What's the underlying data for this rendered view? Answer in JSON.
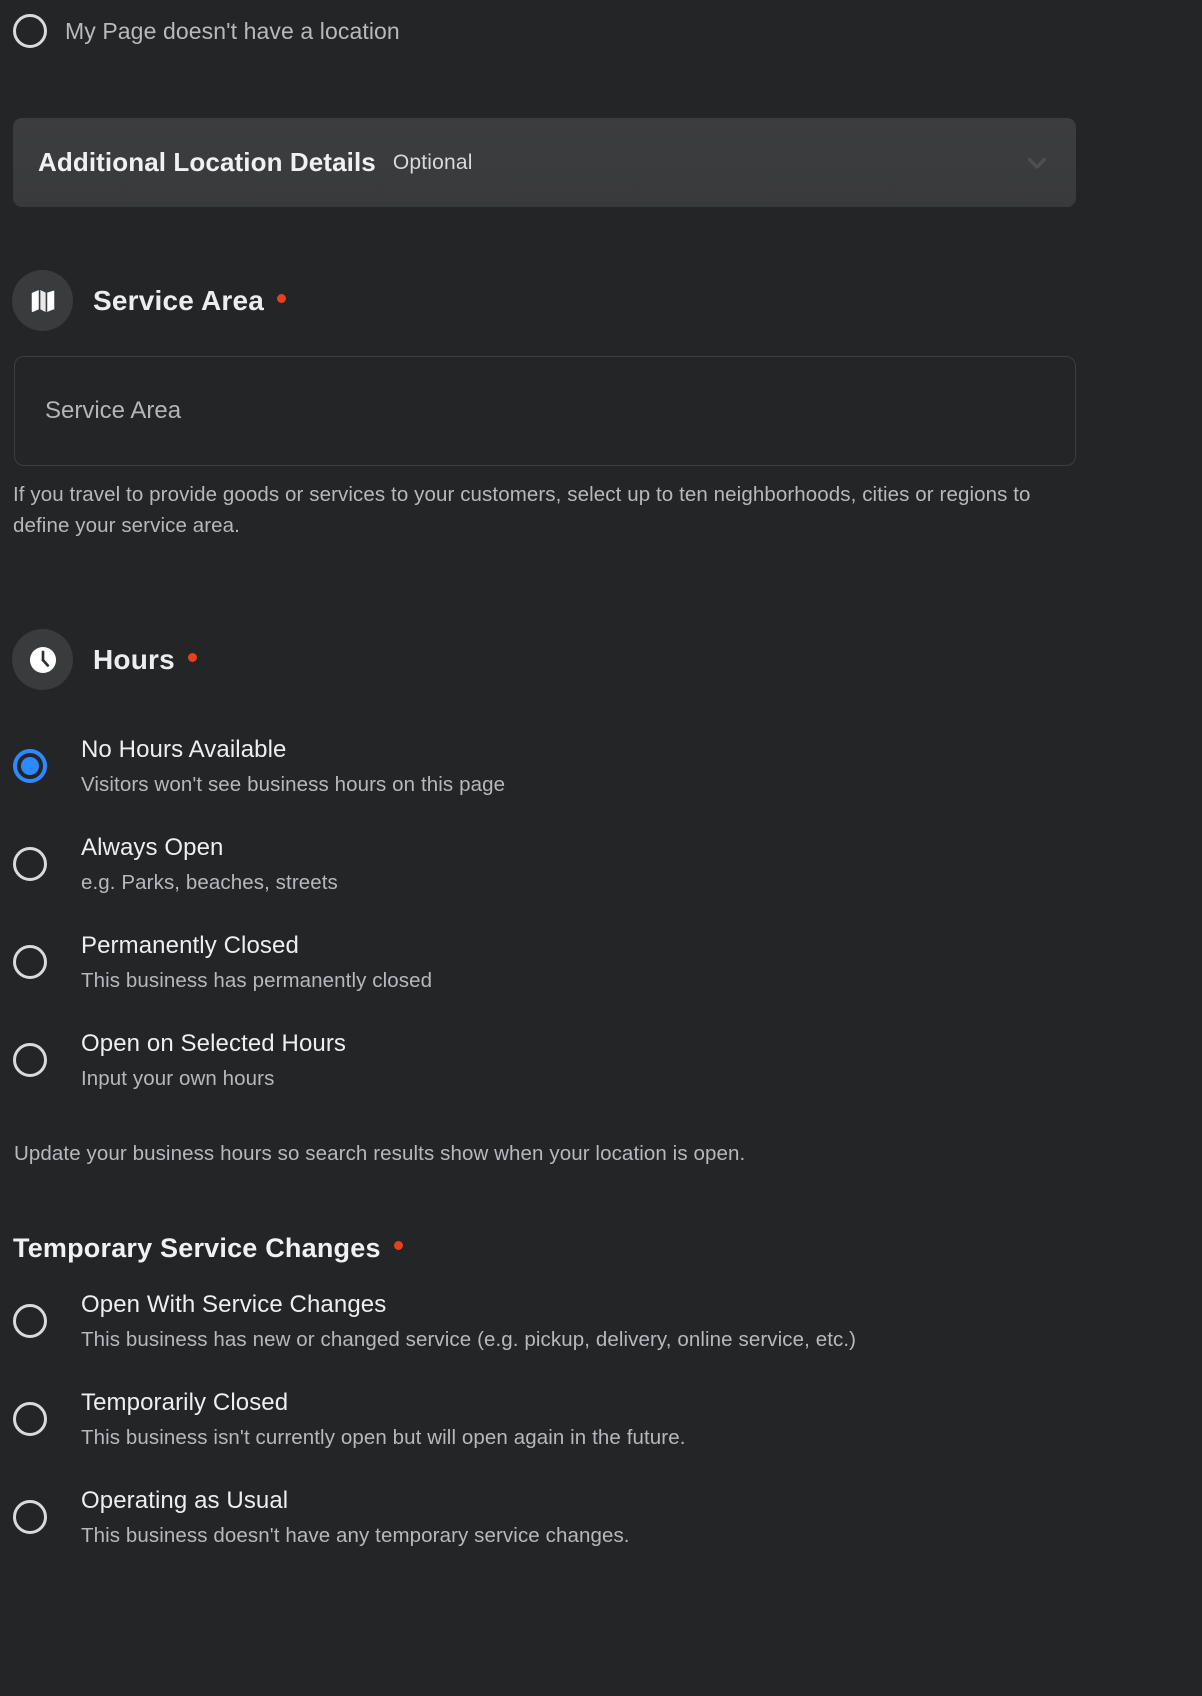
{
  "top_option": {
    "label": "My Page doesn't have a location",
    "selected": false,
    "radio_icon": "radio-unselected-icon"
  },
  "additional_location_details": {
    "title": "Additional Location Details",
    "optional_label": "Optional",
    "chevron_icon": "chevron-down-icon",
    "expanded": false
  },
  "service_area": {
    "icon": "map-icon",
    "title": "Service Area",
    "required_marker": "•",
    "input": {
      "value": "",
      "placeholder": "Service Area"
    },
    "helper_text": "If you travel to provide goods or services to your customers, select up to ten neighborhoods, cities or regions to define your service area."
  },
  "hours": {
    "icon": "clock-icon",
    "title": "Hours",
    "required_marker": "•",
    "options": [
      {
        "label": "No Hours Available",
        "description": "Visitors won't see business hours on this page",
        "selected": true
      },
      {
        "label": "Always Open",
        "description": "e.g. Parks, beaches, streets",
        "selected": false
      },
      {
        "label": "Permanently Closed",
        "description": "This business has permanently closed",
        "selected": false
      },
      {
        "label": "Open on Selected Hours",
        "description": "Input your own hours",
        "selected": false
      }
    ],
    "helper_text": "Update your business hours so search results show when your location is open."
  },
  "temporary_service_changes": {
    "title": "Temporary Service Changes",
    "required_marker": "•",
    "options": [
      {
        "label": "Open With Service Changes",
        "description": "This business has new or changed service (e.g. pickup, delivery, online service, etc.)",
        "selected": false
      },
      {
        "label": "Temporarily Closed",
        "description": "This business isn't currently open but will open again in the future.",
        "selected": false
      },
      {
        "label": "Operating as Usual",
        "description": "This business doesn't have any temporary service changes.",
        "selected": false
      }
    ]
  },
  "colors": {
    "background": "#242526",
    "panel": "#3c3d3f",
    "accent_blue": "#2e89ff",
    "required_red": "#e4421f",
    "primary_text": "#e4e6eb",
    "secondary_text": "#b5b8bc"
  }
}
